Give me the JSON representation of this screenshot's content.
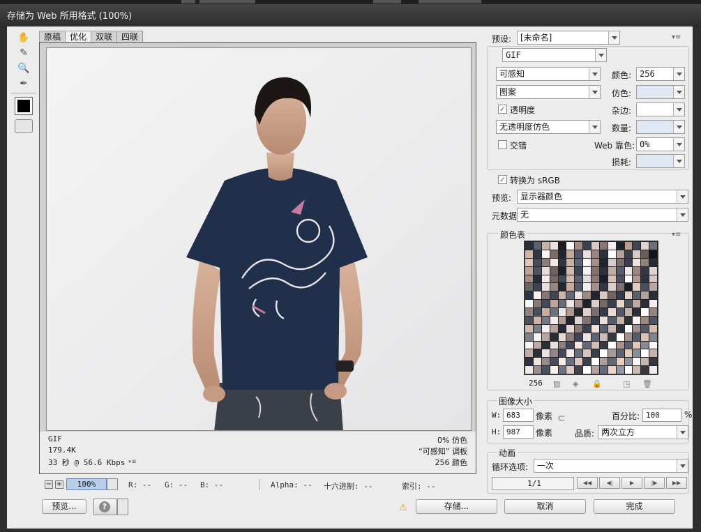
{
  "window": {
    "title": "存储为 Web 所用格式 (100%)"
  },
  "tabs": [
    {
      "label": "原稿",
      "active": false
    },
    {
      "label": "优化",
      "active": true
    },
    {
      "label": "双联",
      "active": false
    },
    {
      "label": "四联",
      "active": false
    }
  ],
  "canvas_info": {
    "format": "GIF",
    "size": "179.4K",
    "download": "33 秒 @ 56.6 Kbps",
    "dither": "0% 仿色",
    "palette": "“可感知” 调板",
    "colors": "256 颜色"
  },
  "status": {
    "zoom": "100%",
    "r": "R: --",
    "g": "G: --",
    "b": "B: --",
    "alpha": "Alpha: --",
    "hex": "十六进制: --",
    "index": "索引: --"
  },
  "buttons": {
    "preview": "预览...",
    "save": "存储...",
    "cancel": "取消",
    "done": "完成"
  },
  "settings": {
    "preset_label": "预设:",
    "preset_value": "[未命名]",
    "format": "GIF",
    "reduction": "可感知",
    "dither_algo": "图案",
    "transparency_label": "透明度",
    "transparency_checked": true,
    "transparency_dither": "无透明度仿色",
    "interlaced_label": "交错",
    "interlaced_checked": false,
    "colors_label": "颜色:",
    "colors_value": "256",
    "dither_label": "仿色:",
    "matte_label": "杂边:",
    "amount_label": "数量:",
    "web_snap_label": "Web 靠色:",
    "web_snap_value": "0%",
    "lossy_label": "损耗:",
    "convert_srgb_label": "转换为 sRGB",
    "convert_srgb_checked": true,
    "preview_label": "预览:",
    "preview_value": "显示器颜色",
    "metadata_label": "元数据:",
    "metadata_value": "无"
  },
  "color_table": {
    "title": "颜色表",
    "count": "256",
    "colors": [
      "#2a2f3a",
      "#5b6270",
      "#c9b3a6",
      "#e9e3e3",
      "#1e1c22",
      "#ffffff",
      "#a18d86",
      "#3a4150",
      "#d6c8c6",
      "#8a7774",
      "#f2f0f2",
      "#1b2230",
      "#b89c8e",
      "#404653",
      "#e1d5d3",
      "#6e6e7a",
      "#d3b6a2",
      "#303848",
      "#f7f5f6",
      "#7c6c68",
      "#22262e",
      "#c4a99b",
      "#505766",
      "#e8dede",
      "#99857f",
      "#2b3342",
      "#fafafa",
      "#b5a29c",
      "#3c3f48",
      "#dccbc4",
      "#6a5e5d",
      "#111418",
      "#e0c6b8",
      "#454c5a",
      "#8f7d79",
      "#f0e8e8",
      "#2f3541",
      "#c8b1a8",
      "#5e6573",
      "#ffffff",
      "#a6918a",
      "#1f2430",
      "#d9cdca",
      "#7a6f6e",
      "#384050",
      "#efe4e0",
      "#92807b",
      "#272b33",
      "#bfa294",
      "#4e5562",
      "#e5dcdc",
      "#6f6260",
      "#1c2029",
      "#d1b9ad",
      "#3e4654",
      "#f5f2f3",
      "#857370",
      "#2c313c",
      "#c2ada5",
      "#575d6a",
      "#ece6e7",
      "#9c8781",
      "#33394a",
      "#dfd3cf",
      "#a88e82",
      "#262c38",
      "#f3ecec",
      "#796966",
      "#414857",
      "#cfbbb2",
      "#5a6070",
      "#e6dfe0",
      "#8d7a75",
      "#1a1e26",
      "#d8c2b6",
      "#4a5060",
      "#fbfafa",
      "#b09a92",
      "#2e3440",
      "#d4c6c2",
      "#6c6464",
      "#3b4250",
      "#e9e0de",
      "#978680",
      "#23272f",
      "#c6ab9e",
      "#535a68",
      "#f1eeef",
      "#a3908a",
      "#313747",
      "#dccfcc",
      "#7e716f",
      "#181c24",
      "#e2cbbf",
      "#465060",
      "#bba69e",
      "#2d333f",
      "#f6f0ef",
      "#887775",
      "#3f4553",
      "#cdb4a8",
      "#626877",
      "#ebe3e3",
      "#9f8a83",
      "#20252f",
      "#d7c9c6",
      "#706564",
      "#363c4b",
      "#e4d2c8",
      "#59606e",
      "#b3a09a",
      "#2a2e36",
      "#f8f6f7",
      "#8b7b78",
      "#444a58",
      "#c3a597",
      "#676d7b",
      "#eee7e7",
      "#a99590",
      "#1d212a",
      "#dbcfcb",
      "#766a68",
      "#3a3f4e",
      "#e7d7cd",
      "#4c5463",
      "#bfaaa1",
      "#292d35",
      "#f4efee",
      "#928380",
      "#474e5c",
      "#c9ae9f",
      "#6b717e",
      "#efe9ea",
      "#ad9892",
      "#24282f",
      "#ded2cf",
      "#7b6e6c",
      "#353b4a",
      "#eadbd2",
      "#51586a",
      "#c2b0a8",
      "#2b2f37",
      "#fcfbfb",
      "#95847f",
      "#4b515e",
      "#cfb3a4",
      "#727884",
      "#f2ecec",
      "#b19d97",
      "#212630",
      "#e0d5d2",
      "#807372",
      "#383e4d",
      "#ecdfd7",
      "#555c6c",
      "#c6b4ac",
      "#2e3239",
      "#f9f4f3",
      "#9a8985",
      "#4f5562",
      "#d4b8a9",
      "#777d89",
      "#f5efef",
      "#b5a19b",
      "#252a33",
      "#e3d8d5",
      "#857877",
      "#3b4150",
      "#eee2db",
      "#596071",
      "#cab8b0",
      "#30343c",
      "#fdfcfc",
      "#9e8d89",
      "#535966",
      "#d8bdae",
      "#7c828d",
      "#f7f2f2",
      "#b9a6a0",
      "#272c35",
      "#e6dbd8",
      "#8a7d7c",
      "#3e4453",
      "#f0e5de",
      "#5d6475",
      "#cebcb4",
      "#33373f",
      "#ffffff",
      "#a2918d",
      "#565c69",
      "#ddc2b3",
      "#808691",
      "#faf5f5",
      "#bdaaa4",
      "#292e37",
      "#e9dfdc",
      "#8e8281",
      "#414756",
      "#f2e8e1",
      "#616879",
      "#d2c0b8",
      "#363a42",
      "#ffffff",
      "#a6958f",
      "#5a606d",
      "#e1c7b8",
      "#858b96",
      "#fcf8f8",
      "#c1aea8",
      "#2c3039",
      "#ece2df",
      "#928786",
      "#444a59",
      "#f4ebe4",
      "#656c7d",
      "#d6c4bc",
      "#393d45",
      "#ffffff",
      "#aa9994",
      "#5e6471",
      "#e5ccbd",
      "#898f9a",
      "#fefcfc",
      "#c5b2ac",
      "#2e333c",
      "#efe5e2",
      "#968b8a",
      "#474d5c",
      "#f6eee7",
      "#697081",
      "#dac8c0",
      "#3c4048",
      "#ffffff",
      "#ae9d98",
      "#626875",
      "#e9d1c2",
      "#8e949f",
      "#ffffff",
      "#c9b6b0",
      "#31363f",
      "#f2e8e5",
      "#9a8f8e",
      "#4a505f",
      "#f8f1ea",
      "#6d7485",
      "#decdc5",
      "#3f434b",
      "#ffffff",
      "#b2a19c",
      "#666c79",
      "#edd6c7",
      "#9298a3",
      "#ffffff",
      "#cdbab4",
      "#343942",
      "#f5ebe8"
    ]
  },
  "image_size": {
    "title": "图像大小",
    "w_label": "W:",
    "w_value": "683",
    "h_label": "H:",
    "h_value": "987",
    "unit": "像素",
    "percent_label": "百分比:",
    "percent_value": "100",
    "percent_unit": "%",
    "quality_label": "品质:",
    "quality_value": "两次立方"
  },
  "animation": {
    "title": "动画",
    "loop_label": "循环选项:",
    "loop_value": "一次",
    "frame": "1/1"
  }
}
